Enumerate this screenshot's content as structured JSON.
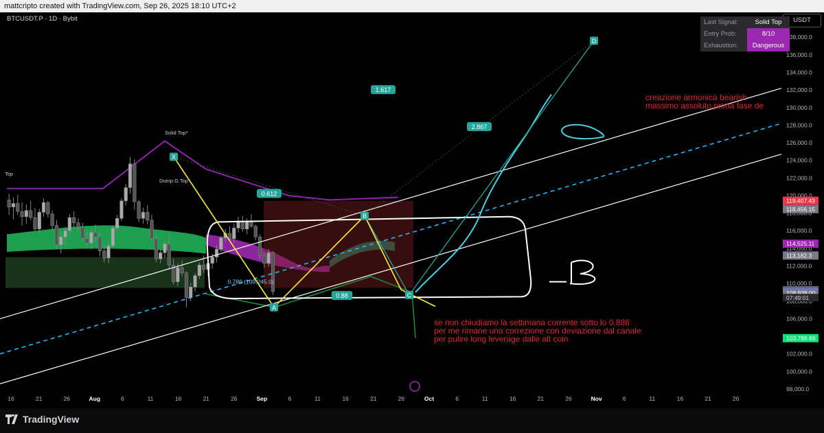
{
  "header": {
    "credit": "mattcripto created with TradingView.com, Sep 26, 2025 18:10 UTC+2"
  },
  "symbol": "BTCUSDT.P · 1D · Bybit",
  "currency": "USDT",
  "signal_panel": [
    {
      "key": "Last Signal:",
      "value": "Solid Top",
      "color": "#2a2a2e"
    },
    {
      "key": "Entry Prob:",
      "value": "8/10",
      "color": "#9c27b0"
    },
    {
      "key": "Exhaustion:",
      "value": "Dangerous",
      "color": "#9c27b0"
    }
  ],
  "annotations": {
    "top_right": "creazione armonica bearish\nmassimo assoluto prima fase de",
    "bottom": "se non chiudiamo la settimana corrente sotto lo 0.886\nper me rimane una correzione con deviazione dal canale\nper pulire long leverage dalle alt coin",
    "indicator_labels": [
      "Solid Top*",
      "Top",
      "Dump G Top"
    ]
  },
  "brand": {
    "logo": "TradingView"
  },
  "chart_data": {
    "type": "candlestick",
    "y_axis": {
      "min": 98000,
      "max": 138000,
      "ticks": [
        98000,
        100000,
        102000,
        104000,
        106000,
        108000,
        110000,
        112000,
        114000,
        116000,
        118000,
        120000,
        122000,
        124000,
        126000,
        128000,
        130000,
        132000,
        134000,
        136000,
        138000
      ]
    },
    "x_ticks": [
      "16",
      "21",
      "26",
      "Aug",
      "6",
      "11",
      "16",
      "21",
      "26",
      "Sep",
      "6",
      "11",
      "16",
      "21",
      "26",
      "Oct",
      "6",
      "11",
      "16",
      "21",
      "26",
      "Nov",
      "6",
      "11",
      "16",
      "21",
      "26"
    ],
    "price_labels": [
      {
        "value": 119407.43,
        "text": "119,407.43",
        "color": "#f23645"
      },
      {
        "value": 118456.15,
        "text": "118,456.15",
        "color": "#787b86"
      },
      {
        "value": 114525.11,
        "text": "114,525.11",
        "color": "#9c27b0"
      },
      {
        "value": 113182.3,
        "text": "113,182.3",
        "color": "#787b86"
      },
      {
        "value": 109218.3,
        "text": "109,218.3",
        "color": "#787b86"
      },
      {
        "value": 109116.3,
        "text": "109,116.30",
        "color": "#000000"
      },
      {
        "value": 109115.9,
        "text": "109,115.90",
        "color": "#2962ff"
      },
      {
        "value": 108958.66,
        "text": "108,958.66",
        "color": "#fbc02d"
      },
      {
        "value": 108938.0,
        "text": "108,938.00",
        "color": "#787b86"
      },
      {
        "value": 103788.89,
        "text": "103,788.89",
        "color": "#00e676"
      }
    ],
    "countdown": "07:49:01",
    "harmonic_points": [
      {
        "label": "X",
        "value": 124400
      },
      {
        "label": "A",
        "value": 107300
      },
      {
        "label": "B",
        "value": 117700
      },
      {
        "label": "C",
        "value": 108700
      },
      {
        "label": "D",
        "value": 137600
      }
    ],
    "fib_labels": [
      {
        "text": "0.612",
        "value": 120200
      },
      {
        "text": "0.88",
        "value": 108600
      },
      {
        "text": "1.617",
        "value": 132000
      },
      {
        "text": "2.867",
        "value": 127800
      },
      {
        "text": "0.786 (109,245.0)",
        "value": 110200
      }
    ],
    "series": [
      {
        "name": "BTCUSDT.P",
        "ohlc": [
          [
            119500,
            120200,
            117800,
            118700
          ],
          [
            118700,
            119800,
            117300,
            119100
          ],
          [
            119100,
            120100,
            117800,
            118200
          ],
          [
            118200,
            119200,
            116600,
            117600
          ],
          [
            117600,
            119000,
            116800,
            118300
          ],
          [
            118300,
            119400,
            117200,
            117500
          ],
          [
            117500,
            118600,
            115900,
            116200
          ],
          [
            116200,
            118500,
            115700,
            118100
          ],
          [
            118100,
            119700,
            117600,
            119200
          ],
          [
            119200,
            119400,
            117500,
            117900
          ],
          [
            117900,
            118300,
            116100,
            116600
          ],
          [
            116600,
            117200,
            113900,
            114400
          ],
          [
            114400,
            115900,
            113400,
            115300
          ],
          [
            115300,
            116400,
            114200,
            116000
          ],
          [
            116000,
            117900,
            115500,
            117500
          ],
          [
            117500,
            118200,
            116300,
            116900
          ],
          [
            116900,
            117400,
            115900,
            116400
          ],
          [
            116400,
            116900,
            114800,
            115100
          ],
          [
            115100,
            115800,
            114100,
            114600
          ],
          [
            114600,
            116200,
            113900,
            115800
          ],
          [
            115800,
            116700,
            114700,
            115300
          ],
          [
            115300,
            115900,
            113100,
            113700
          ],
          [
            113700,
            114400,
            112400,
            112900
          ],
          [
            112900,
            114800,
            112300,
            114300
          ],
          [
            114300,
            116600,
            114000,
            116300
          ],
          [
            116300,
            117800,
            115900,
            117400
          ],
          [
            117400,
            119700,
            117100,
            119400
          ],
          [
            119400,
            121300,
            118900,
            120900
          ],
          [
            120900,
            124400,
            120200,
            123600
          ],
          [
            123600,
            124100,
            118400,
            119300
          ],
          [
            119300,
            119500,
            117000,
            117400
          ],
          [
            117400,
            118600,
            116800,
            118100
          ],
          [
            118100,
            118900,
            116700,
            117200
          ],
          [
            117200,
            117800,
            114800,
            115100
          ],
          [
            115100,
            115500,
            112400,
            112800
          ],
          [
            112800,
            113900,
            112300,
            113500
          ],
          [
            113500,
            114900,
            112900,
            114500
          ],
          [
            114500,
            115600,
            111600,
            112100
          ],
          [
            112100,
            112800,
            109900,
            110200
          ],
          [
            110200,
            112300,
            109700,
            111800
          ],
          [
            111800,
            112600,
            110800,
            111200
          ],
          [
            111200,
            111400,
            107300,
            108400
          ],
          [
            108400,
            110100,
            108000,
            109600
          ],
          [
            109600,
            111200,
            109100,
            110900
          ],
          [
            110900,
            112400,
            110500,
            112100
          ],
          [
            112100,
            113200,
            111200,
            111600
          ],
          [
            111600,
            112700,
            110800,
            112300
          ],
          [
            112300,
            113400,
            111700,
            113000
          ],
          [
            113000,
            114300,
            112400,
            113900
          ],
          [
            113900,
            115400,
            113600,
            115200
          ],
          [
            115200,
            116200,
            114700,
            115700
          ],
          [
            115700,
            116500,
            114800,
            115100
          ],
          [
            115100,
            116800,
            114600,
            116300
          ],
          [
            116300,
            117600,
            115800,
            117100
          ],
          [
            117100,
            117700,
            115900,
            116200
          ],
          [
            116200,
            117400,
            115600,
            117000
          ],
          [
            117000,
            117900,
            116300,
            116500
          ],
          [
            116500,
            116700,
            114900,
            115300
          ],
          [
            115300,
            115600,
            112800,
            113200
          ],
          [
            113200,
            113600,
            111800,
            112300
          ],
          [
            112300,
            113900,
            111900,
            113500
          ],
          [
            113500,
            113700,
            108700,
            109100
          ]
        ]
      }
    ]
  }
}
